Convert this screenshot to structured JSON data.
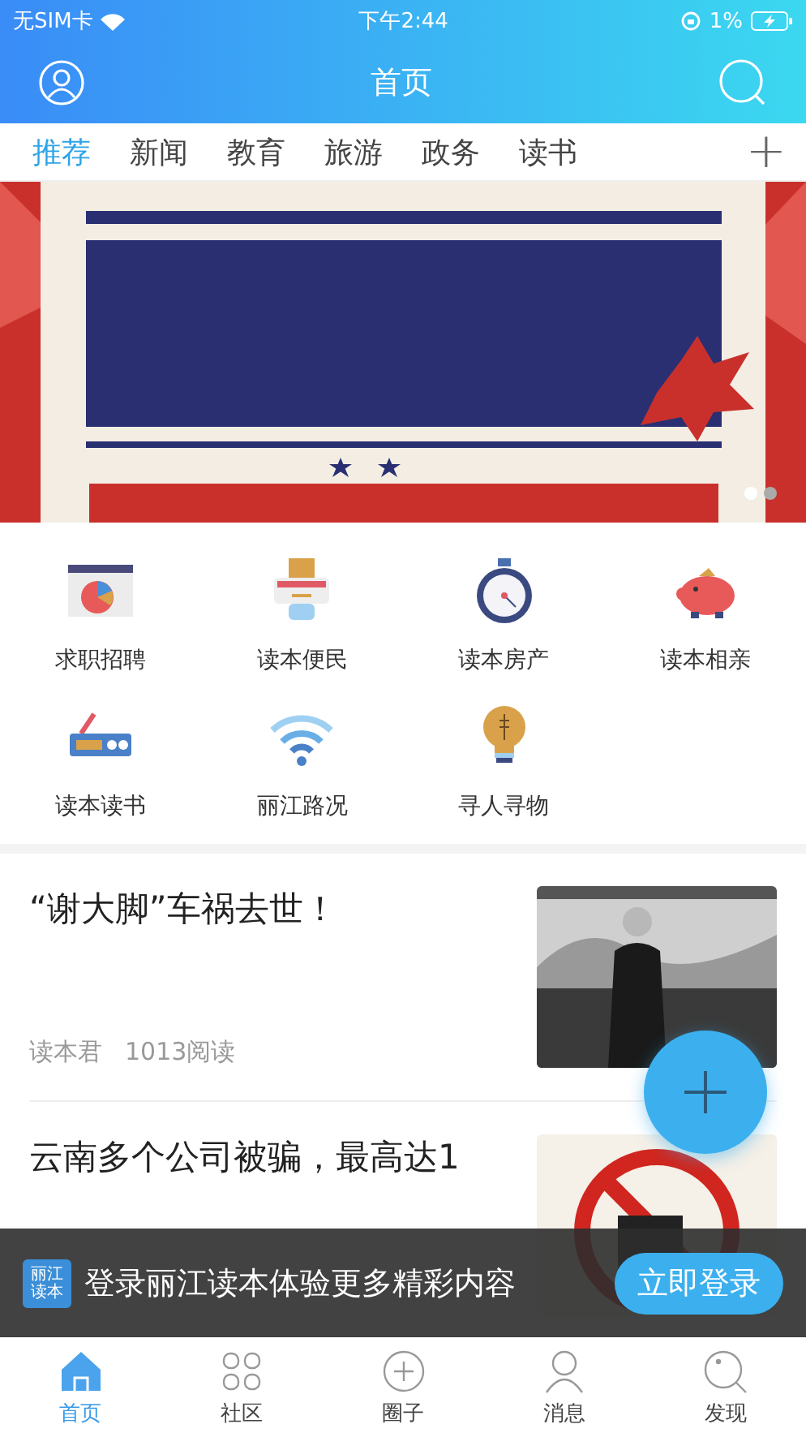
{
  "status_bar": {
    "carrier": "无SIM卡",
    "time": "下午2:44",
    "battery": "1%"
  },
  "header": {
    "title": "首页"
  },
  "channels": [
    {
      "label": "推荐",
      "selected": true
    },
    {
      "label": "新闻",
      "selected": false
    },
    {
      "label": "教育",
      "selected": false
    },
    {
      "label": "旅游",
      "selected": false
    },
    {
      "label": "政务",
      "selected": false
    },
    {
      "label": "读书",
      "selected": false
    }
  ],
  "add_channel": "+",
  "banner": {
    "slides": [
      {
        "selected": true
      },
      {
        "selected": false
      }
    ]
  },
  "services": [
    {
      "label": "求职招聘"
    },
    {
      "label": "读本便民"
    },
    {
      "label": "读本房产"
    },
    {
      "label": "读本相亲"
    },
    {
      "label": "读本读书"
    },
    {
      "label": "丽江路况"
    },
    {
      "label": "寻人寻物"
    }
  ],
  "articles": [
    {
      "title": "“谢大脚”车祸去世！",
      "author": "读本君",
      "reads": "1013阅读"
    },
    {
      "title": "云南多个公司被骗，最高达1"
    }
  ],
  "login_bar": {
    "app_name": "丽江读本",
    "text": "登录丽江读本体验更多精彩内容",
    "button": "立即登录"
  },
  "bottom_tabs": [
    {
      "label": "首页",
      "selected": true
    },
    {
      "label": "社区",
      "selected": false
    },
    {
      "label": "圈子",
      "selected": false
    },
    {
      "label": "消息",
      "selected": false
    },
    {
      "label": "发现",
      "selected": false
    }
  ]
}
